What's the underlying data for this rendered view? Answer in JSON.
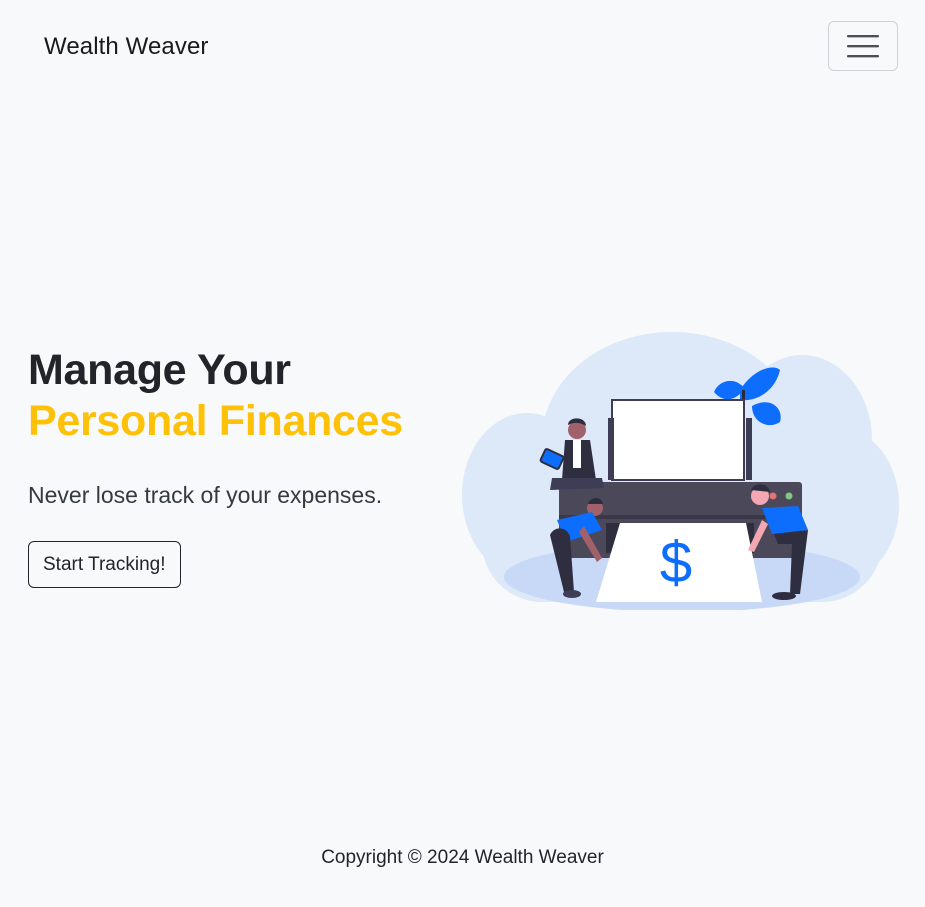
{
  "navbar": {
    "brand": "Wealth Weaver",
    "toggler_icon": "hamburger-menu-icon"
  },
  "hero": {
    "headline_part1": "Manage Your ",
    "headline_part2": "Personal Finances",
    "tagline": "Never lose track of your expenses.",
    "cta_label": "Start Tracking!",
    "illustration_symbol": "$"
  },
  "colors": {
    "accent": "#ffc107",
    "brand_blue": "#0d6efd",
    "background": "#f8f9fa"
  },
  "footer": {
    "copyright": "Copyright © 2024 Wealth Weaver"
  }
}
